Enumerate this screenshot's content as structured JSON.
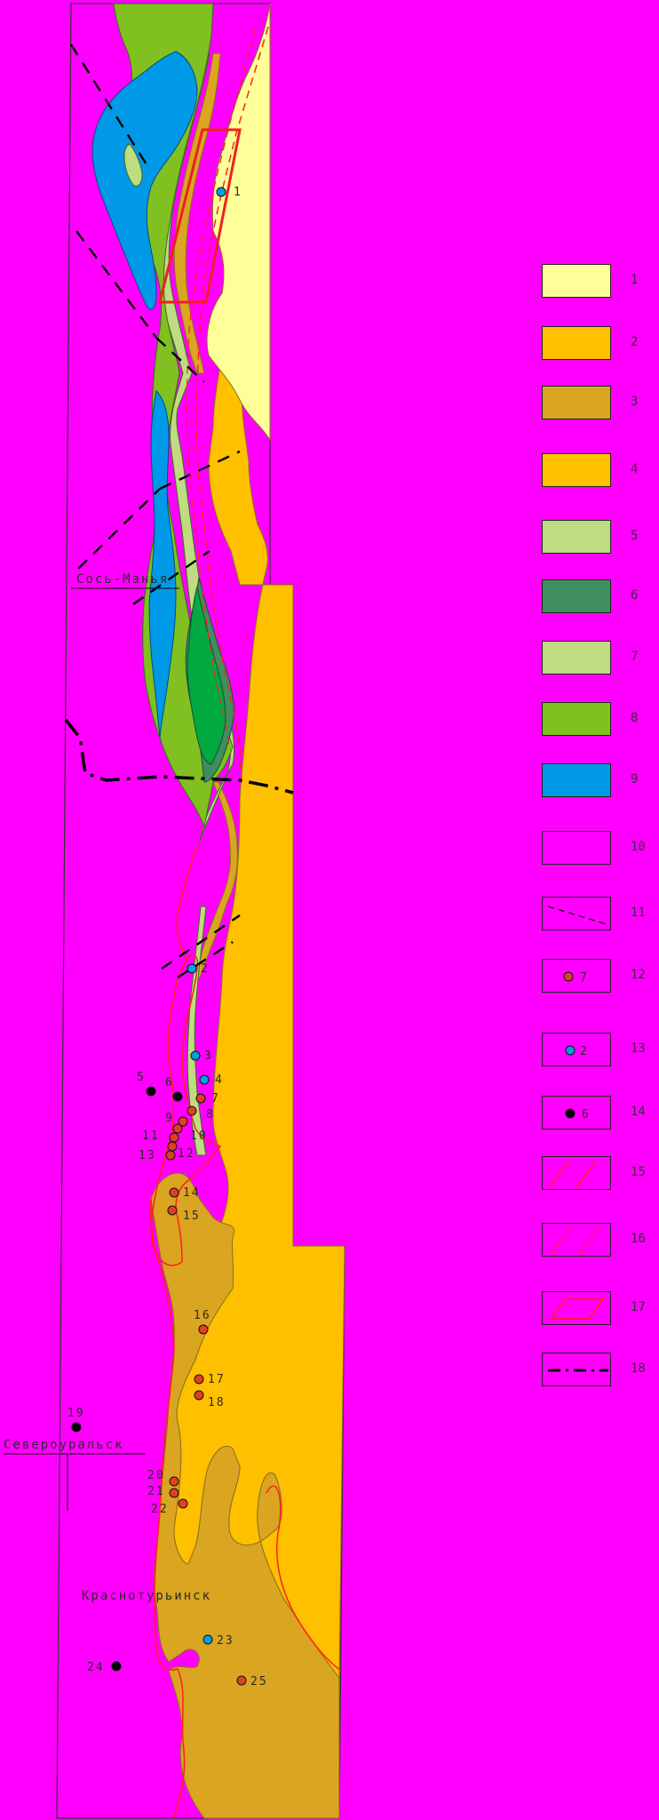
{
  "places": {
    "north_town": "Сось-Манья",
    "mid_town": "Североуральск",
    "south_town": "Краснотурьинск"
  },
  "sites": [
    {
      "label": "1",
      "type": "blue"
    },
    {
      "label": "2",
      "type": "blue"
    },
    {
      "label": "3",
      "type": "blue"
    },
    {
      "label": "4",
      "type": "blue"
    },
    {
      "label": "5",
      "type": "black"
    },
    {
      "label": "6",
      "type": "black"
    },
    {
      "label": "7",
      "type": "red"
    },
    {
      "label": "8",
      "type": "red"
    },
    {
      "label": "9",
      "type": "red"
    },
    {
      "label": "10",
      "type": "red"
    },
    {
      "label": "11",
      "type": "red"
    },
    {
      "label": "12",
      "type": "red"
    },
    {
      "label": "13",
      "type": "red"
    },
    {
      "label": "14",
      "type": "red"
    },
    {
      "label": "15",
      "type": "red"
    },
    {
      "label": "16",
      "type": "red"
    },
    {
      "label": "17",
      "type": "red"
    },
    {
      "label": "18",
      "type": "red"
    },
    {
      "label": "19",
      "type": "black"
    },
    {
      "label": "20",
      "type": "red"
    },
    {
      "label": "21",
      "type": "red"
    },
    {
      "label": "22",
      "type": "red"
    },
    {
      "label": "23",
      "type": "blue"
    },
    {
      "label": "24",
      "type": "black"
    },
    {
      "label": "25",
      "type": "red"
    }
  ],
  "legend": [
    {
      "num": "1",
      "kind": "fill",
      "color": "#ffff99"
    },
    {
      "num": "2",
      "kind": "fill",
      "color": "#ffc000"
    },
    {
      "num": "3",
      "kind": "fill",
      "color": "#daa520"
    },
    {
      "num": "4",
      "kind": "fill",
      "color": "#ffc000"
    },
    {
      "num": "5",
      "kind": "fill",
      "color": "#c0dc80"
    },
    {
      "num": "6",
      "kind": "fill",
      "color": "#3f8e60"
    },
    {
      "num": "7",
      "kind": "fill",
      "color": "#c0dc80"
    },
    {
      "num": "8",
      "kind": "fill",
      "color": "#80c020"
    },
    {
      "num": "9",
      "kind": "fill",
      "color": "#0099e8"
    },
    {
      "num": "10",
      "kind": "fill",
      "color": "#ff00ff"
    },
    {
      "num": "11",
      "kind": "dashed-line",
      "color": "#000000"
    },
    {
      "num": "12",
      "kind": "red-point",
      "label": "7",
      "color": "#e04020"
    },
    {
      "num": "13",
      "kind": "blue-point",
      "label": "2",
      "color": "#00a0e0"
    },
    {
      "num": "14",
      "kind": "black-point",
      "label": "6",
      "color": "#000000"
    },
    {
      "num": "15",
      "kind": "red-solid-lines",
      "color": "#ff2020"
    },
    {
      "num": "16",
      "kind": "red-dashed-lines",
      "color": "#ff2020"
    },
    {
      "num": "17",
      "kind": "red-parallelogram",
      "color": "#ff2020"
    },
    {
      "num": "18",
      "kind": "dash-dot-line",
      "color": "#000000"
    }
  ],
  "colors": {
    "background": "#ff00ff",
    "frame": "#333333",
    "light_yellow": "#ffff99",
    "orange": "#ffc000",
    "ochre": "#daa520",
    "light_green": "#c0dc80",
    "dark_green": "#3f8e60",
    "bright_green": "#00aa40",
    "grass_green": "#80c020",
    "blue": "#0099e8",
    "red": "#ff2020"
  }
}
